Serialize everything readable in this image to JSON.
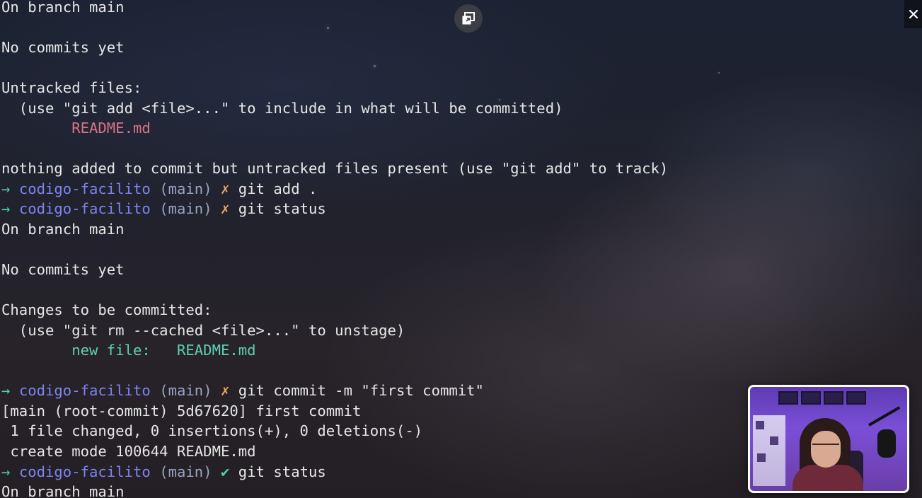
{
  "terminal": {
    "lines": [
      [
        {
          "t": "On branch main",
          "c": ""
        }
      ],
      [],
      [
        {
          "t": "No commits yet",
          "c": ""
        }
      ],
      [],
      [
        {
          "t": "Untracked files:",
          "c": ""
        }
      ],
      [
        {
          "t": "  (use \"git add <file>...\" to include in what will be committed)",
          "c": ""
        }
      ],
      [
        {
          "t": "        ",
          "c": ""
        },
        {
          "t": "README.md",
          "c": "t-red"
        }
      ],
      [],
      [
        {
          "t": "nothing added to commit but untracked files present (use \"git add\" to track)",
          "c": ""
        }
      ],
      [
        {
          "t": "→ ",
          "c": "t-arrow"
        },
        {
          "t": "codigo-facilito",
          "c": "t-dir"
        },
        {
          "t": " (main)",
          "c": "t-branch"
        },
        {
          "t": " ✗ ",
          "c": "t-x"
        },
        {
          "t": "git add .",
          "c": ""
        }
      ],
      [
        {
          "t": "→ ",
          "c": "t-arrow"
        },
        {
          "t": "codigo-facilito",
          "c": "t-dir"
        },
        {
          "t": " (main)",
          "c": "t-branch"
        },
        {
          "t": " ✗ ",
          "c": "t-x"
        },
        {
          "t": "git status",
          "c": ""
        }
      ],
      [
        {
          "t": "On branch main",
          "c": ""
        }
      ],
      [],
      [
        {
          "t": "No commits yet",
          "c": ""
        }
      ],
      [],
      [
        {
          "t": "Changes to be committed:",
          "c": ""
        }
      ],
      [
        {
          "t": "  (use \"git rm --cached <file>...\" to unstage)",
          "c": ""
        }
      ],
      [
        {
          "t": "        ",
          "c": ""
        },
        {
          "t": "new file:   README.md",
          "c": "t-green"
        }
      ],
      [],
      [
        {
          "t": "→ ",
          "c": "t-arrow"
        },
        {
          "t": "codigo-facilito",
          "c": "t-dir"
        },
        {
          "t": " (main)",
          "c": "t-branch"
        },
        {
          "t": " ✗ ",
          "c": "t-x"
        },
        {
          "t": "git commit -m \"first commit\"",
          "c": ""
        }
      ],
      [
        {
          "t": "[main (root-commit) 5d67620] first commit",
          "c": ""
        }
      ],
      [
        {
          "t": " 1 file changed, 0 insertions(+), 0 deletions(-)",
          "c": ""
        }
      ],
      [
        {
          "t": " create mode 100644 README.md",
          "c": ""
        }
      ],
      [
        {
          "t": "→ ",
          "c": "t-arrow"
        },
        {
          "t": "codigo-facilito",
          "c": "t-dir"
        },
        {
          "t": " (main)",
          "c": "t-branch"
        },
        {
          "t": " ✔ ",
          "c": "t-check"
        },
        {
          "t": "git status",
          "c": ""
        }
      ],
      [
        {
          "t": "On branch main",
          "c": ""
        }
      ]
    ]
  },
  "controls": {
    "popout_icon": "picture-in-picture-icon",
    "close_icon": "close-icon"
  },
  "colors": {
    "untracked_file": "#d9728a",
    "staged_file": "#5fd0b4",
    "prompt_arrow": "#4fd1a6",
    "prompt_dir": "#7e83f0",
    "prompt_branch": "#9aa2c4",
    "prompt_dirty": "#e9a86a"
  },
  "webcam": {
    "description_icon": "presenter-webcam"
  }
}
